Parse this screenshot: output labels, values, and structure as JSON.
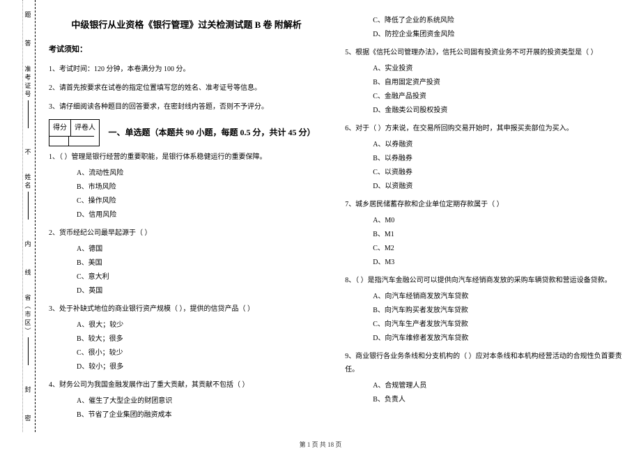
{
  "side": {
    "field_province": "省（市区）",
    "field_name": "姓名",
    "field_ticket": "准考证号",
    "seal_mark": "密",
    "seal_seal": "封",
    "seal_line": "线",
    "seal_inside": "内",
    "seal_no": "不",
    "seal_ans": "答",
    "seal_q": "题"
  },
  "header": {
    "title": "中级银行从业资格《银行管理》过关检测试题 B 卷  附解析",
    "notice_head": "考试须知：",
    "notice_items": [
      "1、考试时间：120 分钟，本卷满分为 100 分。",
      "2、请首先按要求在试卷的指定位置填写您的姓名、准考证号等信息。",
      "3、请仔细阅读各种题目的回答要求，在密封线内答题，否则不予评分。"
    ]
  },
  "score_table": {
    "h1": "得分",
    "h2": "评卷人"
  },
  "section1": {
    "title": "一、单选题（本题共 90 小题，每题 0.5 分，共计 45 分）"
  },
  "questions_left": [
    {
      "stem": "1、（    ）管理是银行经营的重要职能，是银行体系稳健运行的重要保障。",
      "options": [
        "A、流动性风险",
        "B、市场风险",
        "C、操作风险",
        "D、信用风险"
      ]
    },
    {
      "stem": "2、货币经纪公司最早起源于（    ）",
      "options": [
        "A、德国",
        "B、美国",
        "C、意大利",
        "D、英国"
      ]
    },
    {
      "stem": "3、处于补缺式地位的商业银行资产规模（    ），提供的信贷产品（    ）",
      "options": [
        "A、很大；较少",
        "B、较大；很多",
        "C、很小；较少",
        "D、较小；很多"
      ]
    },
    {
      "stem": "4、财务公司为我国金融发展作出了重大贡献，其贡献不包括（    ）",
      "options": [
        "A、催生了大型企业的财团意识",
        "B、节省了企业集团的融资成本"
      ]
    }
  ],
  "questions_right_prefix": {
    "options": [
      "C、降低了企业的系统风险",
      "D、防控企业集团资金风险"
    ]
  },
  "questions_right": [
    {
      "stem": "5、根据《信托公司管理办法》，信托公司固有投资业务不可开展的投资类型是（    ）",
      "options": [
        "A、实业投资",
        "B、自用固定资产投资",
        "C、金融产品投资",
        "D、金融类公司股权投资"
      ]
    },
    {
      "stem": "6、对于（      ）方来说，在交易所回购交易开始时，其申报买卖部位为买入。",
      "options": [
        "A、以券融资",
        "B、以券融券",
        "C、以资融券",
        "D、以资融资"
      ]
    },
    {
      "stem": "7、城乡居民储蓄存款和企业单位定期存款属于（    ）",
      "options": [
        "A、M0",
        "B、M1",
        "C、M2",
        "D、M3"
      ]
    },
    {
      "stem": "8、（    ）是指汽车金融公司可以提供向汽车经销商发放的采购车辆贷款和营运设备贷款。",
      "options": [
        "A、向汽车经销商发放汽车贷款",
        "B、向汽车购买者发放汽车贷款",
        "C、向汽车生产者发放汽车贷款",
        "D、向汽车维修者发放汽车贷款"
      ]
    },
    {
      "stem": "9、商业银行各业务条线和分支机构的（    ）应对本条线和本机构经营活动的合规性负首要责任。",
      "options": [
        "A、合规管理人员",
        "B、负责人"
      ]
    }
  ],
  "footer": "第 1 页 共 18 页"
}
